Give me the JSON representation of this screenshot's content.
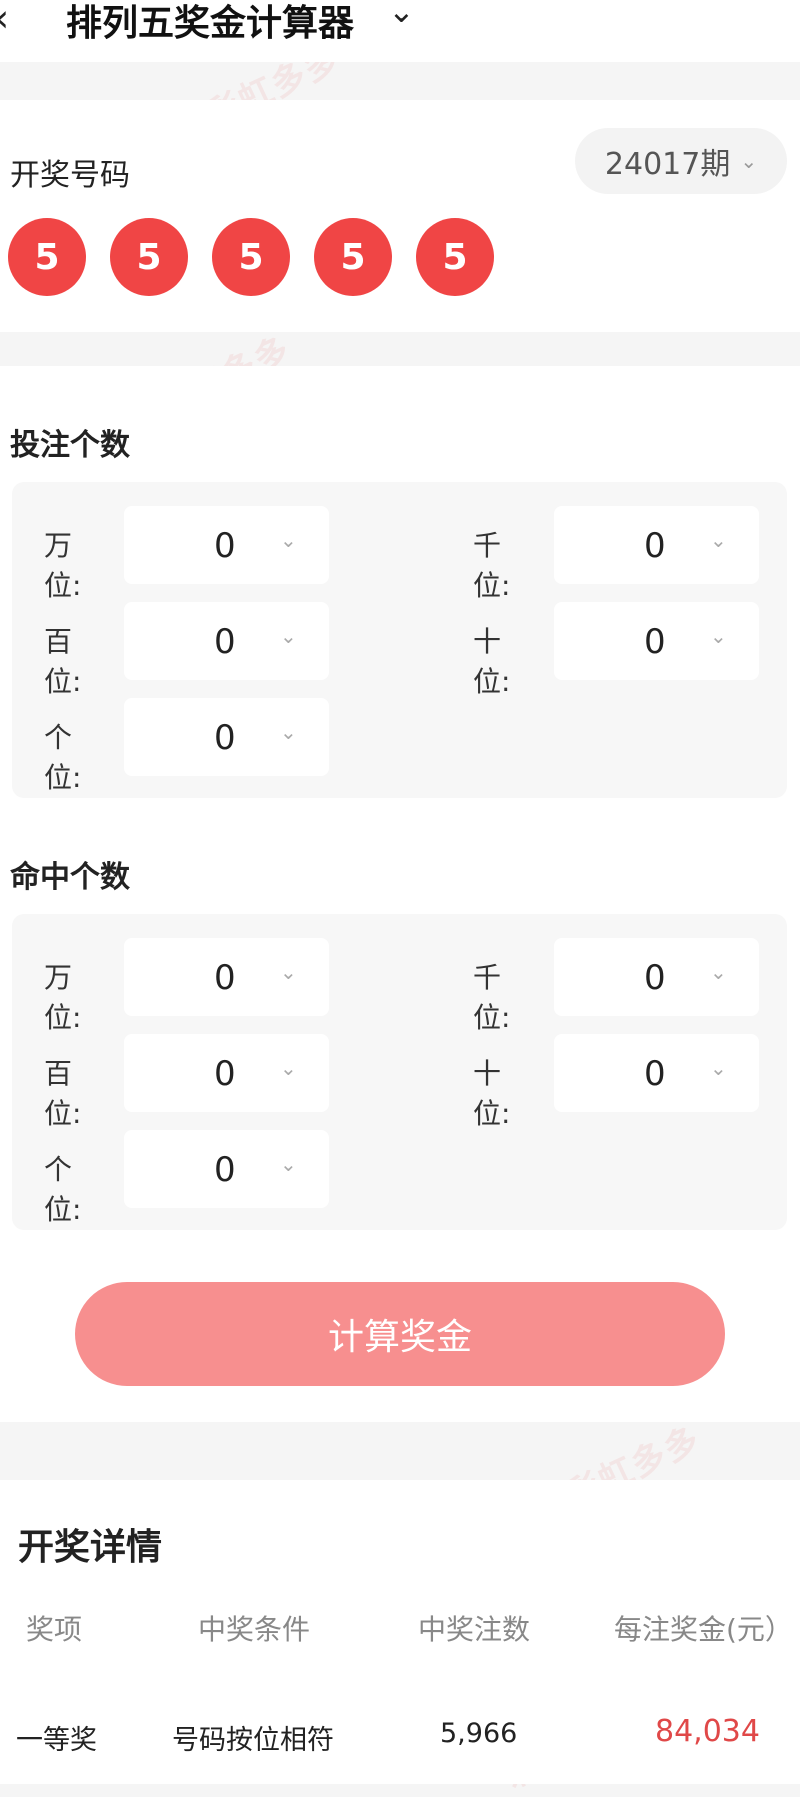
{
  "header": {
    "back_icon": "chevron-left-icon",
    "title": "排列五奖金计算器",
    "title_dropdown_icon": "chevron-down-icon"
  },
  "draw": {
    "label": "开奖号码",
    "issue": "24017期",
    "numbers": [
      "5",
      "5",
      "5",
      "5",
      "5"
    ],
    "ball_color": "#f04545"
  },
  "bet": {
    "title": "投注个数",
    "fields": [
      {
        "label": "万位:",
        "value": "0"
      },
      {
        "label": "千位:",
        "value": "0"
      },
      {
        "label": "百位:",
        "value": "0"
      },
      {
        "label": "十位:",
        "value": "0"
      },
      {
        "label": "个位:",
        "value": "0"
      }
    ]
  },
  "hit": {
    "title": "命中个数",
    "fields": [
      {
        "label": "万位:",
        "value": "0"
      },
      {
        "label": "千位:",
        "value": "0"
      },
      {
        "label": "百位:",
        "value": "0"
      },
      {
        "label": "十位:",
        "value": "0"
      },
      {
        "label": "个位:",
        "value": "0"
      }
    ]
  },
  "calc_button": {
    "label": "计算奖金",
    "color": "#f78f8f"
  },
  "details": {
    "title": "开奖详情",
    "columns": [
      "奖项",
      "中奖条件",
      "中奖注数",
      "每注奖金(元）"
    ],
    "rows": [
      {
        "prize": "一等奖",
        "condition": "号码按位相符",
        "count": "5,966",
        "amount": "84,034"
      }
    ],
    "amount_color": "#e04848"
  },
  "watermark": "彩虹多多"
}
